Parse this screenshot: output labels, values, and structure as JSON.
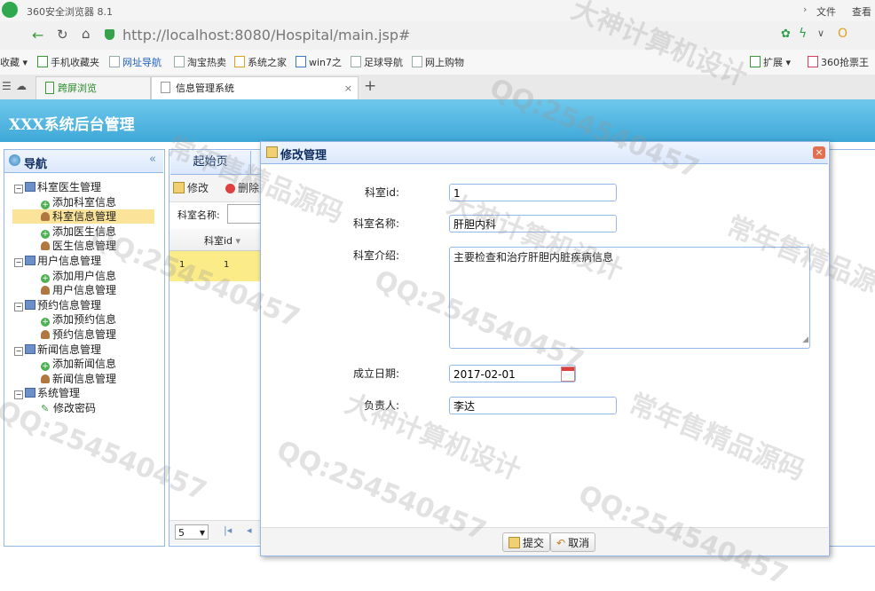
{
  "browser": {
    "title": "360安全浏览器 8.1",
    "menu": [
      "文件",
      "查看"
    ],
    "url": "http://localhost:8080/Hospital/main.jsp#",
    "bookmarks": [
      "收藏",
      "手机收藏夹",
      "网址导航",
      "淘宝热卖",
      "系统之家",
      "win7之",
      "足球导航",
      "网上购物"
    ],
    "right_tools": [
      "扩展",
      "360抢票王"
    ],
    "tabs": [
      "跨屏浏览",
      "信息管理系统"
    ]
  },
  "app": {
    "title": "XXX系统后台管理",
    "nav_title": "导航",
    "start_tab": "起始页",
    "toolbar_edit": "修改",
    "toolbar_delete": "删除",
    "search_label": "科室名称:",
    "grid_header": "科室id",
    "grid_row_num": "1",
    "grid_row_val": "1",
    "page_size": "5"
  },
  "tree": [
    {
      "label": "科室医生管理",
      "type": "group"
    },
    {
      "label": "添加科室信息",
      "type": "add"
    },
    {
      "label": "科室信息管理",
      "type": "user",
      "selected": true
    },
    {
      "label": "添加医生信息",
      "type": "add"
    },
    {
      "label": "医生信息管理",
      "type": "user"
    },
    {
      "label": "用户信息管理",
      "type": "group"
    },
    {
      "label": "添加用户信息",
      "type": "add"
    },
    {
      "label": "用户信息管理",
      "type": "user"
    },
    {
      "label": "预约信息管理",
      "type": "group"
    },
    {
      "label": "添加预约信息",
      "type": "add"
    },
    {
      "label": "预约信息管理",
      "type": "user"
    },
    {
      "label": "新闻信息管理",
      "type": "group"
    },
    {
      "label": "添加新闻信息",
      "type": "add"
    },
    {
      "label": "新闻信息管理",
      "type": "user"
    },
    {
      "label": "系统管理",
      "type": "group"
    },
    {
      "label": "修改密码",
      "type": "pen"
    }
  ],
  "dialog": {
    "title": "修改管理",
    "fields": {
      "id_label": "科室id:",
      "id_value": "1",
      "name_label": "科室名称:",
      "name_value": "肝胆内科",
      "intro_label": "科室介绍:",
      "intro_value": "主要检查和治疗肝胆内脏疾病信息",
      "date_label": "成立日期:",
      "date_value": "2017-02-01",
      "owner_label": "负责人:",
      "owner_value": "李达"
    },
    "submit": "提交",
    "cancel": "取消"
  },
  "watermarks": [
    "大神计算机设计",
    "QQ:254540457",
    "常年售精品源码"
  ]
}
